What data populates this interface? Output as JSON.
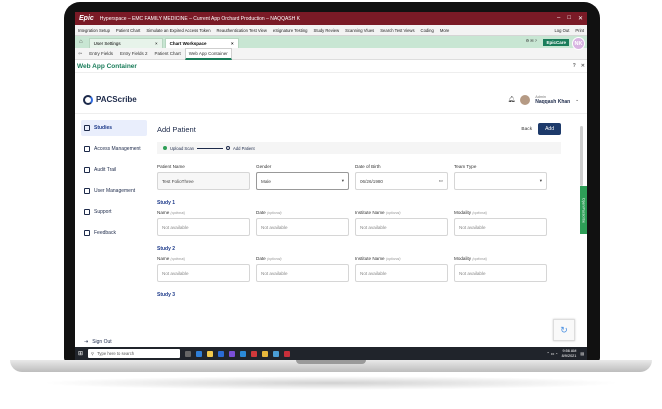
{
  "epic": {
    "title": "Hyperspace – EMC FAMILY MEDICINE – Current App Orchard Production – NAQQASH K",
    "logo": "Epic",
    "menu": [
      "Integration Setup",
      "Patient Chart",
      "Simulate an Expired Access Token",
      "Reauthentication Test View",
      "eSignature Testing",
      "Study Review",
      "Scanning Vlues",
      "Search Test Views",
      "Coding",
      "More"
    ],
    "menu_right": [
      "Log Out",
      "Print"
    ],
    "window_tabs": [
      {
        "label": "User Settings",
        "active": false
      },
      {
        "label": "Chart Workspace",
        "active": true
      }
    ],
    "epiccare": "EpicCare",
    "initials": "NK",
    "sub_tabs": [
      {
        "label": "Entry Fields",
        "active": false
      },
      {
        "label": "Entry Fields 2",
        "active": false
      },
      {
        "label": "Patient Chart",
        "active": false
      },
      {
        "label": "Web App Container",
        "active": true
      }
    ],
    "container_title": "Web App Container",
    "side_tab": "Open Pacscribe"
  },
  "app": {
    "logo_text": "PACScribe",
    "user": {
      "role": "Admin",
      "name": "Naqqash Khan"
    },
    "nav": [
      {
        "label": "Studies",
        "active": true,
        "icon": "studies-icon"
      },
      {
        "label": "Access Management",
        "active": false,
        "icon": "access-icon"
      },
      {
        "label": "Audit Trail",
        "active": false,
        "icon": "audit-icon"
      },
      {
        "label": "User Management",
        "active": false,
        "icon": "users-icon"
      },
      {
        "label": "Support",
        "active": false,
        "icon": "support-icon"
      },
      {
        "label": "Feedback",
        "active": false,
        "icon": "feedback-icon"
      }
    ],
    "signout": "Sign Out",
    "page_title": "Add Patient",
    "back_label": "Back",
    "add_label": "Add",
    "steps": [
      "Upload Scan",
      "Add Patient"
    ],
    "fields": {
      "patient_name": {
        "label": "Patient Name",
        "value": "Test FolioThree"
      },
      "gender": {
        "label": "Gender",
        "value": "Male"
      },
      "dob": {
        "label": "Date of Birth",
        "value": "06/26/1980"
      },
      "team_type": {
        "label": "Team Type",
        "value": ""
      }
    },
    "optional_hint": "(optional)",
    "study_labels": {
      "name": "Name",
      "date": "Date",
      "institute": "Institute Name",
      "modality": "Modality"
    },
    "not_available": "Not available",
    "studies": [
      "Study 1",
      "Study 2",
      "Study 3"
    ]
  },
  "taskbar": {
    "search_placeholder": "Type here to search",
    "time": "9:56 AM",
    "date": "8/9/2021"
  },
  "colors": {
    "epic_red": "#7a1a26",
    "epic_green": "#1a7d5a",
    "primary": "#1d3a6a"
  }
}
